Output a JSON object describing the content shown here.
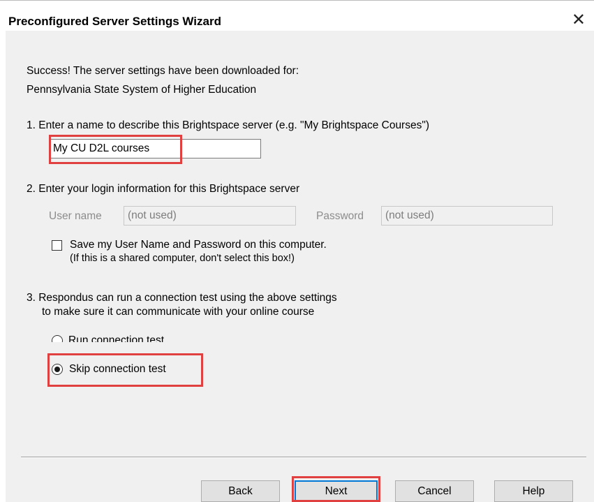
{
  "window": {
    "title": "Preconfigured Server Settings Wizard",
    "close_glyph": "✕"
  },
  "success": {
    "line1": "Success! The server settings have been downloaded for:",
    "line2": "Pennsylvania State System of Higher Education"
  },
  "step1": {
    "label": "1.  Enter a name to describe this Brightspace server (e.g. \"My Brightspace Courses\")",
    "server_name_value": "My CU D2L courses"
  },
  "step2": {
    "label": "2.  Enter your login information for this Brightspace server",
    "username_label": "User name",
    "username_value": "(not used)",
    "password_label": "Password",
    "password_value": "(not used)",
    "save_checkbox_line1": "Save my User Name and Password on this computer.",
    "save_checkbox_line2": "(If this is a shared computer, don't select this box!)",
    "save_checked": false
  },
  "step3": {
    "label_line1": "3.  Respondus can run a connection test using the above settings",
    "label_line2": "to make sure it can communicate with your online course",
    "options": [
      {
        "label": "Run connection test",
        "selected": false
      },
      {
        "label": "Skip connection test",
        "selected": true
      }
    ]
  },
  "buttons": {
    "back": "Back",
    "next": "Next",
    "cancel": "Cancel",
    "help": "Help"
  },
  "colors": {
    "highlight": "#e04040",
    "default_button_border": "#0078d7",
    "dialog_background": "#f0f0f0"
  }
}
